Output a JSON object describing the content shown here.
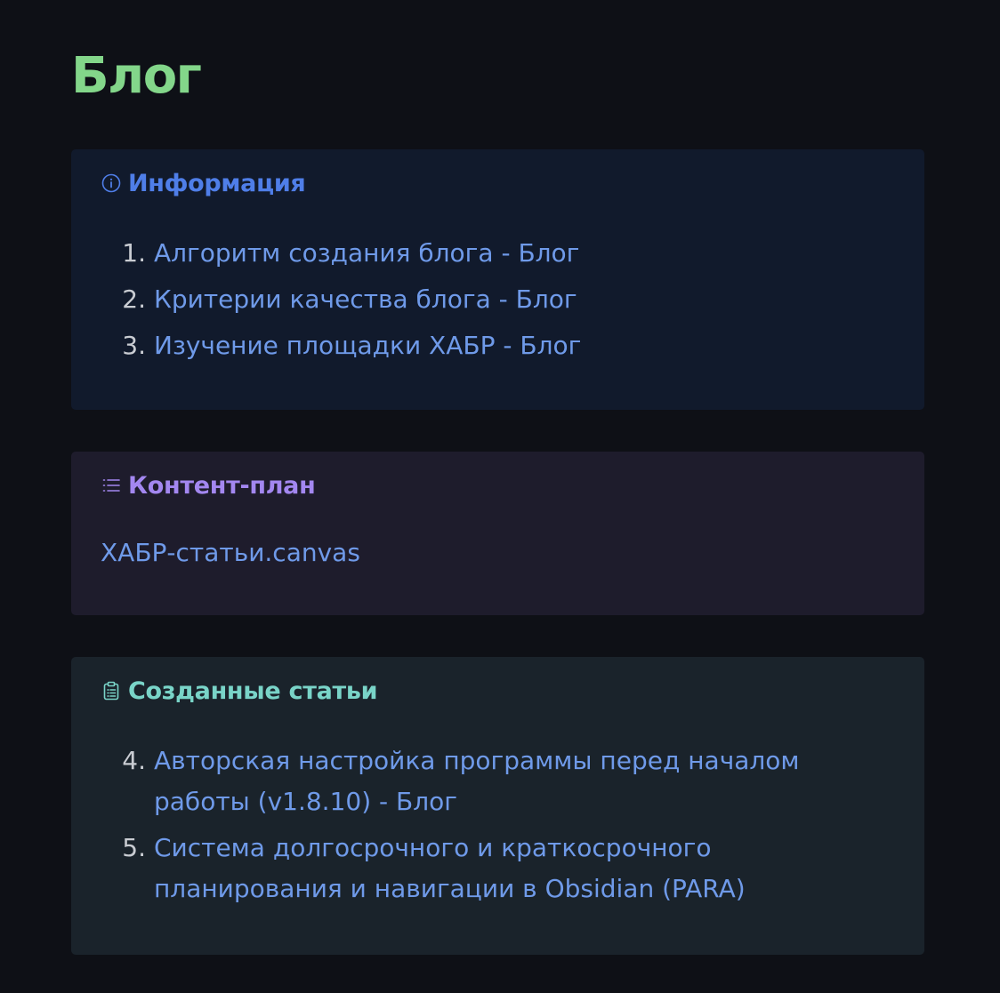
{
  "page": {
    "title": "Блог",
    "title_color": "#83d68a",
    "background": "#0e1016"
  },
  "callouts": {
    "info": {
      "icon": "info-circle-icon",
      "title": "Информация",
      "items": [
        {
          "num": "1.",
          "label": "Алгоритм создания блога - Блог"
        },
        {
          "num": "2.",
          "label": "Критерии качества блога - Блог"
        },
        {
          "num": "3.",
          "label": "Изучение площадки ХАБР - Блог"
        }
      ]
    },
    "plan": {
      "icon": "list-icon",
      "title": "Контент-план",
      "link": "ХАБР-статьи.canvas"
    },
    "articles": {
      "icon": "clipboard-list-icon",
      "title": "Созданные статьи",
      "items": [
        {
          "num": "4.",
          "label": "Авторская настройка программы перед началом работы (v1.8.10) - Блог"
        },
        {
          "num": "5.",
          "label": "Система долгосрочного и краткосрочного планирования и навигации в Obsidian (PARA)"
        }
      ]
    }
  },
  "colors": {
    "link": "#6f9ae9",
    "info_accent": "#4f7ee8",
    "plan_accent": "#a387f0",
    "articles_accent": "#79d4c8"
  }
}
